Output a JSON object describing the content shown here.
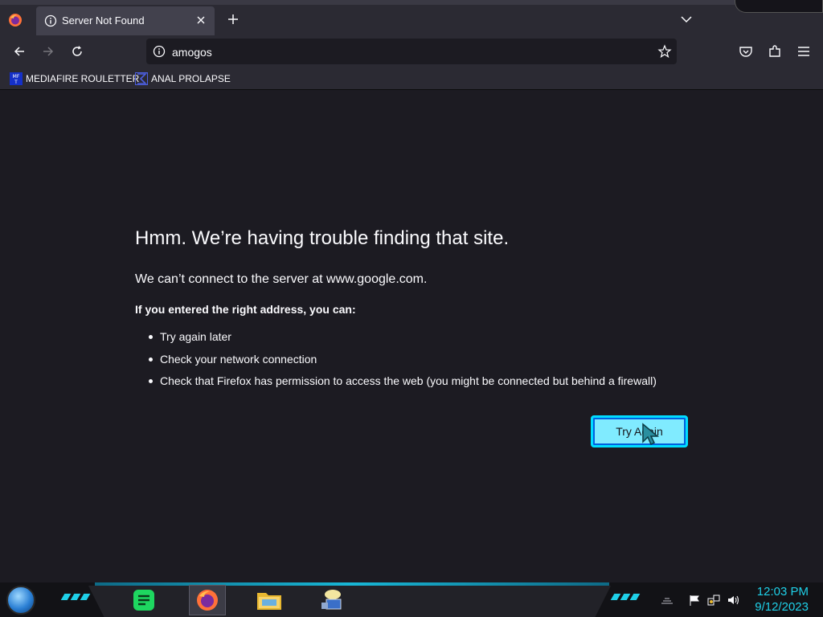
{
  "browser": {
    "tab": {
      "title": "Server Not Found"
    },
    "url": {
      "value": "amogos"
    },
    "bookmarks": [
      {
        "label": "MEDIAFIRE ROULETTER",
        "icon": "mediafire-icon"
      },
      {
        "label": "ANAL PROLAPSE",
        "icon": "bookmark-sigma-icon"
      }
    ]
  },
  "error": {
    "title": "Hmm. We’re having trouble finding that site.",
    "description": "We can’t connect to the server at www.google.com.",
    "subtitle": "If you entered the right address, you can:",
    "suggestions": [
      "Try again later",
      "Check your network connection",
      "Check that Firefox has permission to access the web (you might be connected but behind a firewall)"
    ],
    "button_label": "Try Again"
  },
  "taskbar": {
    "time": "12:03 PM",
    "date": "9/12/2023"
  },
  "colors": {
    "accent": "#00ddff",
    "button_bg": "#80ebff",
    "page_bg": "#1c1b22",
    "chrome_bg": "#2b2a33",
    "clock": "#1fd0e8"
  }
}
